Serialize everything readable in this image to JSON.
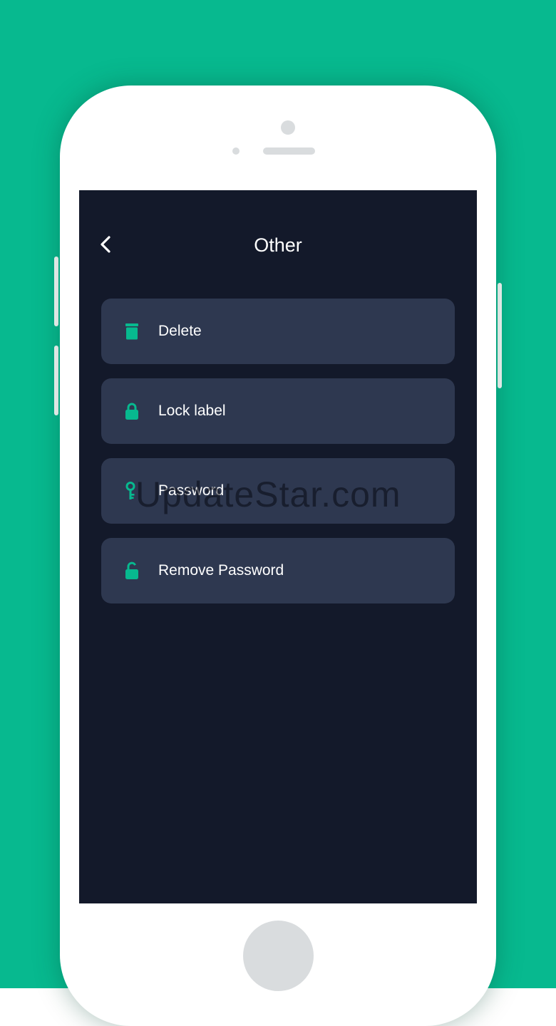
{
  "colors": {
    "background": "#07b98f",
    "screen": "#13192a",
    "card": "#2e3850",
    "icon_accent": "#07b98f",
    "text": "#ffffff"
  },
  "header": {
    "back_icon": "chevron-left-icon",
    "title": "Other"
  },
  "menu": {
    "items": [
      {
        "icon": "trash-icon",
        "label": "Delete"
      },
      {
        "icon": "lock-icon",
        "label": "Lock label"
      },
      {
        "icon": "key-icon",
        "label": "Password"
      },
      {
        "icon": "unlock-icon",
        "label": "Remove Password"
      }
    ]
  },
  "watermark": "UpdateStar.com"
}
